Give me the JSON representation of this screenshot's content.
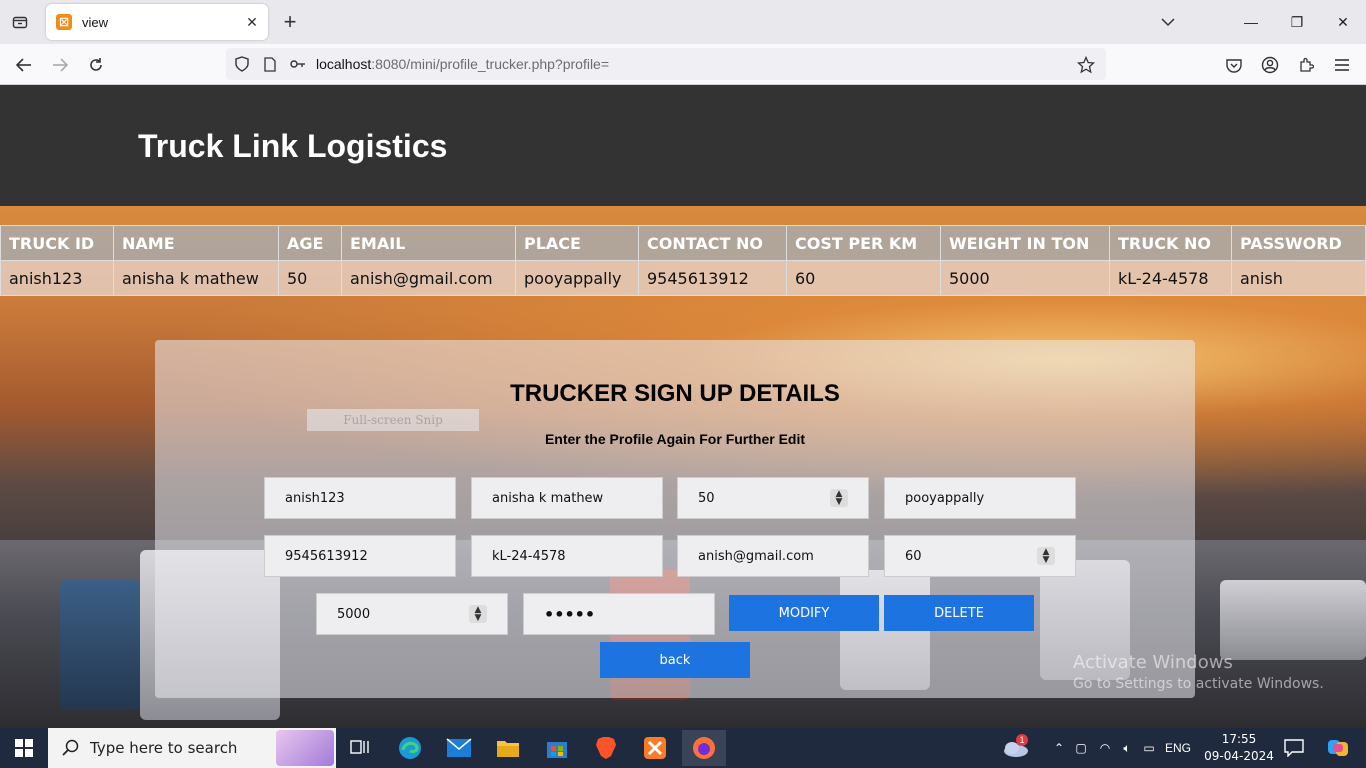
{
  "browser": {
    "tab_title": "view",
    "url_host": "localhost",
    "url_rest": ":8080/mini/profile_trucker.php?profile="
  },
  "site": {
    "title": "Truck Link Logistics"
  },
  "table": {
    "headers": [
      "TRUCK ID",
      "NAME",
      "AGE",
      "EMAIL",
      "PLACE",
      "CONTACT NO",
      "COST PER KM",
      "WEIGHT IN TON",
      "TRUCK NO",
      "PASSWORD"
    ],
    "row": [
      "anish123",
      "anisha k mathew",
      "50",
      "anish@gmail.com",
      "pooyappally",
      "9545613912",
      "60",
      "5000",
      "kL-24-4578",
      "anish"
    ]
  },
  "form": {
    "title": "TRUCKER SIGN UP DETAILS",
    "subtitle": "Enter the Profile Again For Further Edit",
    "snip_overlay": "Full-screen Snip",
    "truck_id": "anish123",
    "name": "anisha k mathew",
    "age": "50",
    "place": "pooyappally",
    "contact": "9545613912",
    "truck_no": "kL-24-4578",
    "email": "anish@gmail.com",
    "cost": "60",
    "weight": "5000",
    "password_mask": "•••••",
    "modify_label": "MODIFY",
    "delete_label": "DELETE",
    "back_label": "back"
  },
  "watermark": {
    "line1": "Activate Windows",
    "line2": "Go to Settings to activate Windows."
  },
  "taskbar": {
    "search_placeholder": "Type here to search",
    "lang": "ENG",
    "time": "17:55",
    "date": "09-04-2024",
    "weather_badge": "1"
  }
}
